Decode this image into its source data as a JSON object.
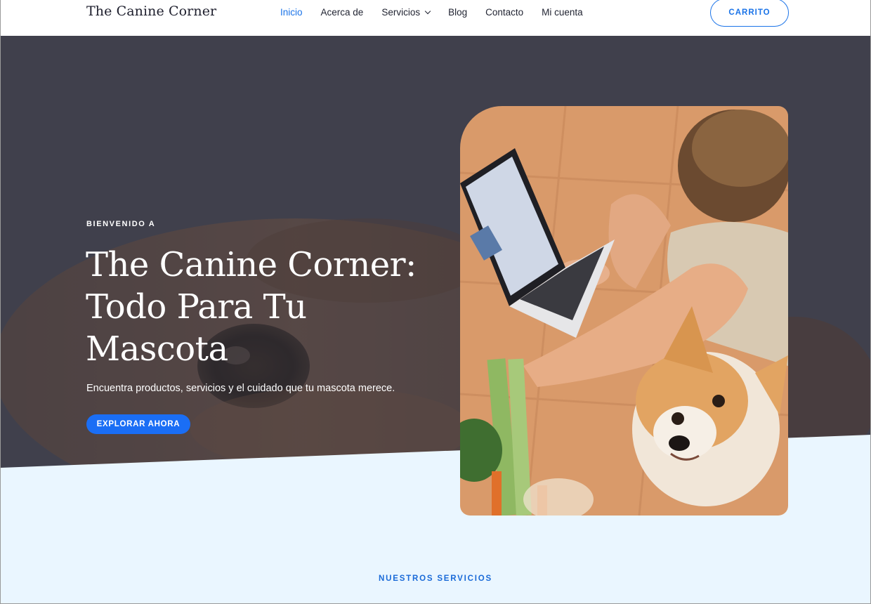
{
  "header": {
    "brand": "The Canine Corner",
    "nav": [
      {
        "label": "Inicio",
        "active": true
      },
      {
        "label": "Acerca de"
      },
      {
        "label": "Servicios",
        "has_dropdown": true
      },
      {
        "label": "Blog"
      },
      {
        "label": "Contacto"
      },
      {
        "label": "Mi cuenta"
      }
    ],
    "cart_label": "CARRITO"
  },
  "hero": {
    "kicker": "BIENVENIDO A",
    "title": "The Canine Corner: Todo Para Tu Mascota",
    "subtitle": "Encuentra productos, servicios y el cuidado que tu mascota merece.",
    "cta_label": "EXPLORAR AHORA",
    "background_image": "close-up-dog-eye-photo",
    "side_image": "woman-with-laptop-and-corgi-photo"
  },
  "section": {
    "label": "NUESTROS SERVICIOS"
  },
  "colors": {
    "accent": "#1a73e8",
    "hero_overlay": "#3f3f4a",
    "section_bg": "#eaf6ff",
    "text_dark": "#1d1e2c"
  },
  "icons": {
    "dropdown": "chevron-down-icon"
  }
}
